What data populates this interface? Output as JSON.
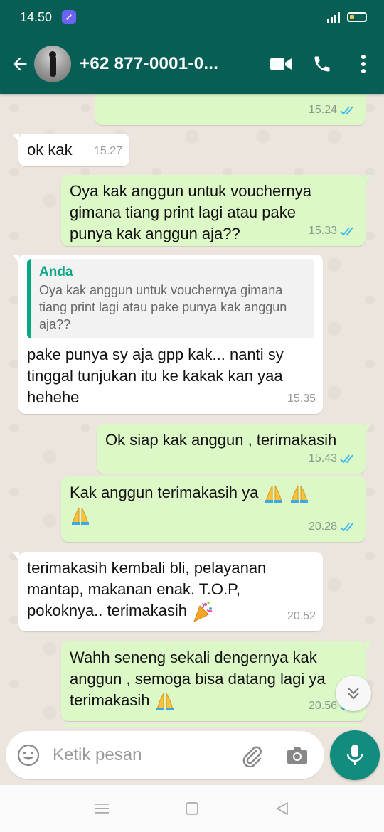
{
  "status_bar": {
    "time": "14.50",
    "icons": [
      "app-notification-icon",
      "signal-icon",
      "battery-icon"
    ]
  },
  "header": {
    "contact_name": "+62 877-0001-0...",
    "icons": [
      "back-arrow-icon",
      "video-call-icon",
      "phone-icon",
      "more-vert-icon"
    ]
  },
  "colors": {
    "header": "#075E54",
    "outgoing_bubble": "#DCF8C6",
    "incoming_bubble": "#FFFFFF",
    "chat_bg": "#ECE5DD",
    "read_ticks": "#34B7F1",
    "quote_accent": "#06A884",
    "mic_button": "#128C7E"
  },
  "messages": [
    {
      "direction": "out",
      "text": "",
      "time": "15.24",
      "status": "read"
    },
    {
      "direction": "in",
      "text": "ok kak",
      "time": "15.27"
    },
    {
      "direction": "out",
      "text": "Oya kak anggun untuk vouchernya gimana tiang print lagi atau pake punya kak anggun aja??",
      "time": "15.33",
      "status": "read"
    },
    {
      "direction": "in",
      "quote_author": "Anda",
      "quote_text": "Oya kak anggun untuk vouchernya gimana tiang print lagi atau pake punya kak anggun aja??",
      "text": "pake punya sy aja gpp kak... nanti sy tinggal tunjukan itu ke kakak kan yaa hehehe",
      "time": "15.35"
    },
    {
      "direction": "out",
      "text": "Ok siap kak anggun , terimakasih",
      "time": "15.43",
      "status": "read"
    },
    {
      "direction": "out",
      "text": "Kak anggun terimakasih ya",
      "emoji": [
        "folded-hands",
        "folded-hands",
        "folded-hands"
      ],
      "time": "20.28",
      "status": "read"
    },
    {
      "direction": "in",
      "text": "terimakasih kembali bli, pelayanan mantap, makanan enak. T.O.P, pokoknya.. terimakasih",
      "emoji": [
        "party-popper"
      ],
      "time": "20.52"
    },
    {
      "direction": "out",
      "text": "Wahh seneng sekali dengernya kak anggun , semoga bisa datang lagi ya terimakasih",
      "emoji": [
        "folded-hands"
      ],
      "time": "20.56",
      "status": "read"
    }
  ],
  "input": {
    "placeholder": "Ketik pesan",
    "value": "",
    "icons": [
      "emoji-icon",
      "attach-icon",
      "camera-icon",
      "mic-icon"
    ]
  },
  "scroll_down_icon": "double-chevron-down-icon",
  "nav_bar": {
    "icons": [
      "menu-icon",
      "home-icon",
      "back-icon"
    ]
  }
}
